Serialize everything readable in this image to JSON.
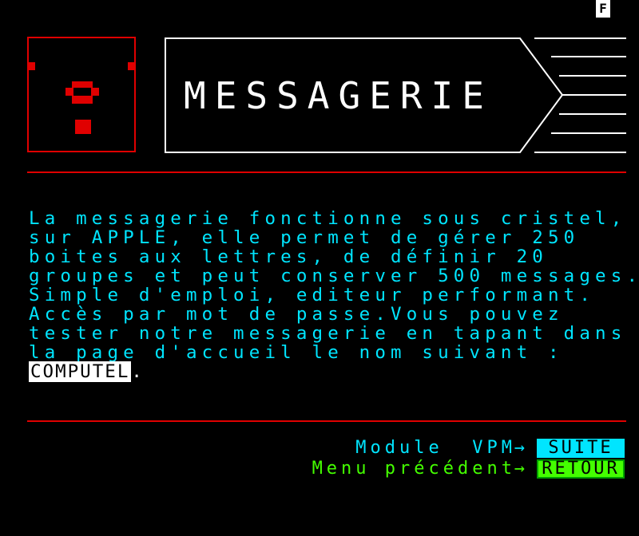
{
  "status": {
    "indicator": "F"
  },
  "header": {
    "title": "MESSAGERIE"
  },
  "body": {
    "lines": [
      "La messagerie fonctionne sous cristel,",
      "sur APPLE, elle permet de gérer 250",
      "boites aux lettres, de définir 20",
      "groupes et peut conserver 500 messages.",
      "Simple d'emploi, editeur performant.",
      "Accès par mot de passe.Vous pouvez",
      "tester notre messagerie en tapant dans",
      "la page d'accueil le nom suivant :"
    ],
    "highlight_name": "COMPUTEL",
    "trailing_dot": "."
  },
  "nav": {
    "next": {
      "label": "Module  VPM",
      "arrow": "→",
      "key": "SUITE"
    },
    "back": {
      "label": "Menu précédent",
      "arrow": "→",
      "key": "RETOUR"
    }
  },
  "colors": {
    "red": "#e00000",
    "cyan": "#00e5ff",
    "green": "#44ff00",
    "white": "#ffffff",
    "background": "#000000"
  }
}
